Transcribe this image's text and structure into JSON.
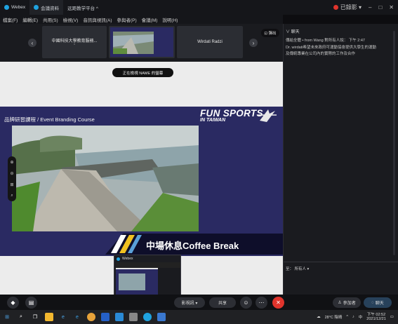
{
  "titlebar": {
    "app": "Webex",
    "tab1": "会議资料",
    "tab2": "远距教学平台 ^",
    "recording": "已錄影 ▾",
    "min": "–",
    "max": "□",
    "close": "✕"
  },
  "menu": [
    "檔案(F)",
    "編輯(E)",
    "共用(S)",
    "檢視(V)",
    "音訊與視訊(A)",
    "參與者(P)",
    "會議(M)",
    "說明(H)"
  ],
  "thumbs": {
    "card1_title": "中國科技大學教育服務...",
    "card1_sub": "*",
    "card3_title": "Wirdati Radzi"
  },
  "stage": {
    "notify": "正在檢視 NAME 的螢幕",
    "slide_header": "品牌研習課程 / Event Branding Course",
    "brand_line1": "FUN SPORTS",
    "brand_line2": "IN TAIWAN",
    "banner": "中場休息Coffee Break"
  },
  "zoom_tools": [
    "⊕",
    "⊖",
    "⊞",
    "⌕"
  ],
  "popup": {
    "title": "Webex"
  },
  "chat": {
    "popout": "⊡ 彈出",
    "header": "∨ 聊天",
    "msg1": "傳給全體 • from Wang 對所有人說：        下午 2:47",
    "msg2": "Dr. wirdati希望未來政府可運動協會提供大學生的運動",
    "msg3": "及傳統專業在公司內的實際的工作及合作",
    "to": "至：  所有人 ▾"
  },
  "controls": {
    "share": "共享",
    "end": "✕",
    "participants": "參加者",
    "chat": "聊天",
    "video_label": "影視訊 ▾"
  },
  "taskbar": {
    "weather": "28°C 陰晴",
    "ime": "中",
    "time": "下午 02:52",
    "date": "2021/12/21"
  }
}
